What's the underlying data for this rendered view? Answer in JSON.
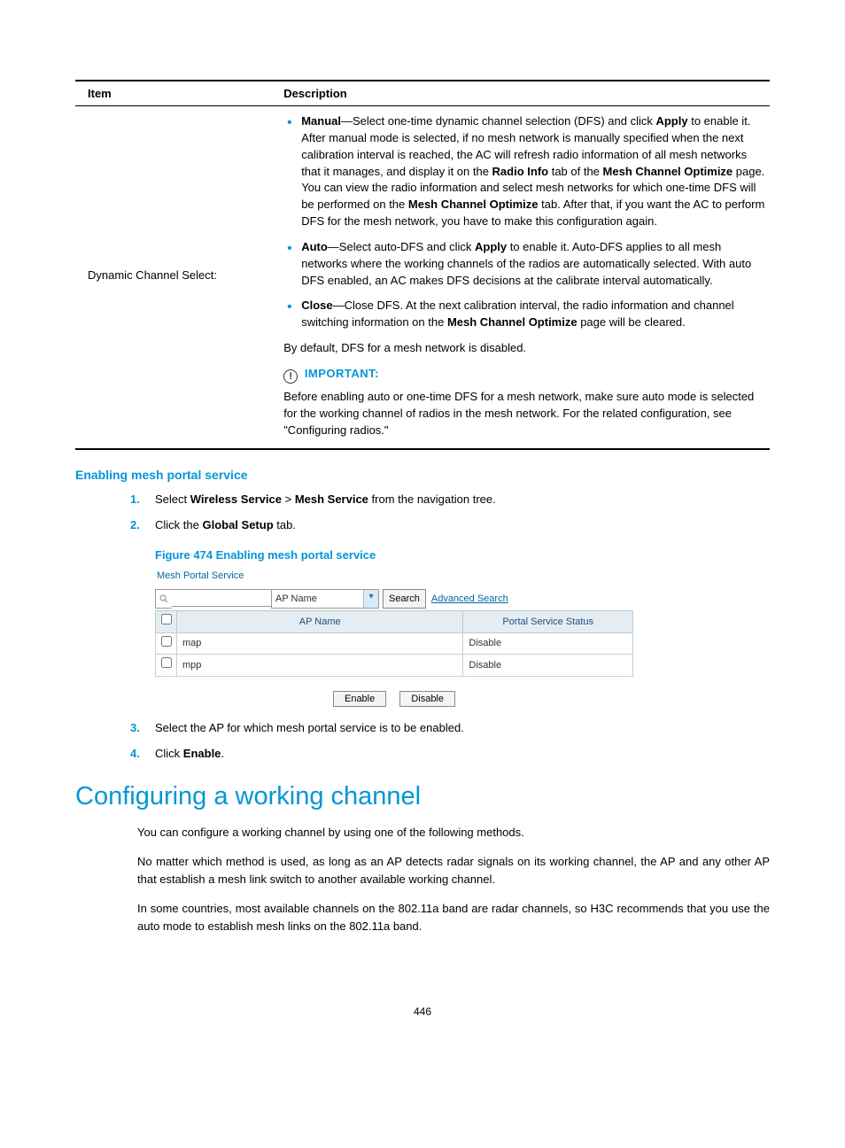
{
  "table": {
    "header_item": "Item",
    "header_desc": "Description",
    "row_item": "Dynamic Channel Select:",
    "bullets": {
      "manual": {
        "prefix": "Manual",
        "dash": "—Select one-time dynamic channel selection (DFS) and click ",
        "apply": "Apply",
        "after_apply": " to enable it. After manual mode is selected, if no mesh network is manually specified when the next calibration interval is reached, the AC will refresh radio information of all mesh networks that it manages, and display it on the ",
        "radio_info": "Radio Info",
        "mid1": " tab of the ",
        "mco1": "Mesh Channel Optimize",
        "mid2": " page. You can view the radio information and select mesh networks for which one-time DFS will be performed on the ",
        "mco2": "Mesh Channel Optimize",
        "tail": " tab. After that, if you want the AC to perform DFS for the mesh network, you have to make this configuration again."
      },
      "auto": {
        "prefix": "Auto",
        "dash": "—Select auto-DFS and click ",
        "apply": "Apply",
        "tail": " to enable it. Auto-DFS applies to all mesh networks where the working channels of the radios are automatically selected. With auto DFS enabled, an AC makes DFS decisions at the calibrate interval automatically."
      },
      "close": {
        "prefix": "Close",
        "dash": "—Close DFS. At the next calibration interval, the radio information and channel switching information on the ",
        "mco": "Mesh Channel Optimize",
        "tail": " page will be cleared."
      }
    },
    "default_line": "By default, DFS for a mesh network is disabled.",
    "important_label": "IMPORTANT:",
    "important_text": "Before enabling auto or one-time DFS for a mesh network, make sure auto mode is selected for the working channel of radios in the mesh network. For the related configuration, see \"Configuring radios.\""
  },
  "subheading_enable": "Enabling mesh portal service",
  "steps_top": {
    "s1_a": "Select ",
    "s1_b": "Wireless Service",
    "s1_c": " > ",
    "s1_d": "Mesh Service",
    "s1_e": " from the navigation tree.",
    "s2_a": "Click the ",
    "s2_b": "Global Setup",
    "s2_c": " tab."
  },
  "figure_caption": "Figure 474 Enabling mesh portal service",
  "inner_ui": {
    "pane_title": "Mesh Portal Service",
    "search_field": "AP Name",
    "search_btn": "Search",
    "adv_link": "Advanced Search",
    "col_name": "AP Name",
    "col_status": "Portal Service Status",
    "rows": [
      {
        "name": "map",
        "status": "Disable"
      },
      {
        "name": "mpp",
        "status": "Disable"
      }
    ],
    "enable_btn": "Enable",
    "disable_btn": "Disable"
  },
  "steps_bottom": {
    "s3": "Select the AP for which mesh portal service is to be enabled.",
    "s4_a": "Click ",
    "s4_b": "Enable",
    "s4_c": "."
  },
  "section_title": "Configuring a working channel",
  "para1": "You can configure a working channel by using one of the following methods.",
  "para2": "No matter which method is used, as long as an AP detects radar signals on its working channel, the AP and any other AP that establish a mesh link switch to another available working channel.",
  "para3": "In some countries, most available channels on the 802.11a band are radar channels, so H3C recommends that you use the auto mode to establish mesh links on the 802.11a band.",
  "page_number": "446"
}
